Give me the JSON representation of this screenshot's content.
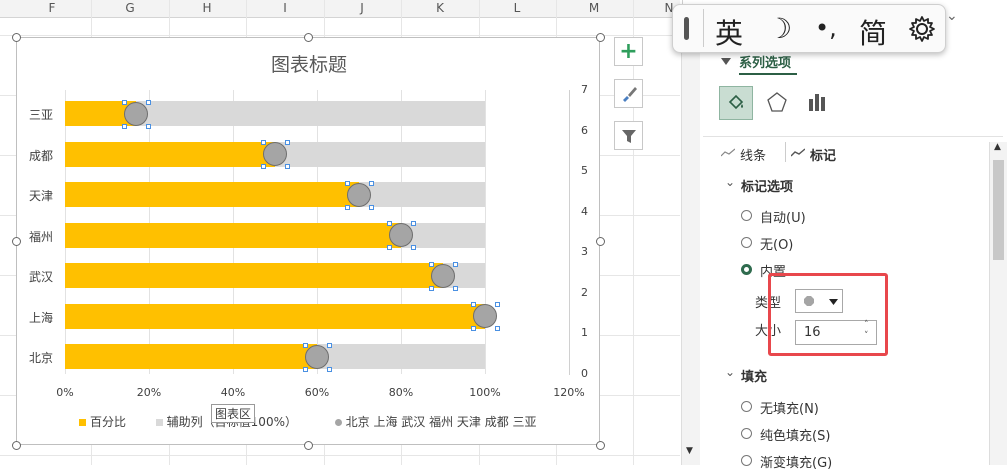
{
  "sheet": {
    "columns": [
      "F",
      "G",
      "H",
      "I",
      "J",
      "K",
      "L",
      "M",
      "N"
    ]
  },
  "chart": {
    "title": "图表标题",
    "legend": {
      "series1": "百分比",
      "series2": "辅助列（目标值100%）",
      "series3": "北京 上海 武汉 福州 天津 成都 三亚"
    },
    "tooltip": "图表区",
    "colors": {
      "percent": "#ffc000",
      "helper": "#d9d9d9",
      "marker": "#a5a5a5"
    }
  },
  "chart_data": {
    "type": "bar",
    "title": "图表标题",
    "categories": [
      "三亚",
      "成都",
      "天津",
      "福州",
      "武汉",
      "上海",
      "北京"
    ],
    "series": [
      {
        "name": "百分比",
        "values": [
          0.17,
          0.5,
          0.7,
          0.8,
          0.9,
          1.0,
          0.6
        ]
      },
      {
        "name": "辅助列（目标值100%）",
        "values": [
          1,
          1,
          1,
          1,
          1,
          1,
          1
        ]
      },
      {
        "name": "北京 上海 武汉 福州 天津 成都 三亚",
        "type": "scatter",
        "values": [
          0.17,
          0.5,
          0.7,
          0.8,
          0.9,
          1.0,
          0.6
        ]
      }
    ],
    "x_ticks": [
      "0%",
      "20%",
      "40%",
      "60%",
      "80%",
      "100%",
      "120%"
    ],
    "xlim": [
      0,
      1.2
    ],
    "y2_ticks": [
      "0",
      "1",
      "2",
      "3",
      "4",
      "5",
      "6",
      "7"
    ],
    "y2lim": [
      0,
      7
    ],
    "grid": true,
    "legend_position": "bottom"
  },
  "side_buttons": [
    {
      "icon": "plus-icon"
    },
    {
      "icon": "brush-icon"
    },
    {
      "icon": "filter-icon"
    }
  ],
  "ime": {
    "mode": "英",
    "moon": "☽",
    "punct": "•,",
    "script": "简",
    "icon": "gear-icon"
  },
  "panel": {
    "section": "系列选项",
    "tab_line": "线条",
    "tab_marker": "标记",
    "marker_options": "标记选项",
    "opt_auto": "自动(U)",
    "opt_none": "无(O)",
    "opt_builtin": "内置",
    "type_label": "类型",
    "size_label": "大小",
    "size_value": "16",
    "fill_section": "填充",
    "fill_none": "无填充(N)",
    "fill_solid": "纯色填充(S)",
    "fill_gradient": "渐变填充(G)"
  }
}
